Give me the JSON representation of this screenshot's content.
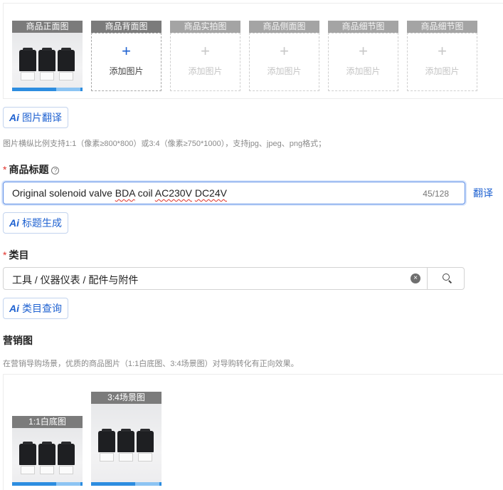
{
  "images": {
    "slots": [
      {
        "label": "商品正面图",
        "has_image": true
      },
      {
        "label": "商品背面图",
        "has_image": false,
        "add_text": "添加图片",
        "active": true
      },
      {
        "label": "商品实拍图",
        "has_image": false,
        "add_text": "添加图片",
        "active": false
      },
      {
        "label": "商品侧面图",
        "has_image": false,
        "add_text": "添加图片",
        "active": false
      },
      {
        "label": "商品细节图",
        "has_image": false,
        "add_text": "添加图片",
        "active": false
      },
      {
        "label": "商品细节图",
        "has_image": false,
        "add_text": "添加图片",
        "active": false
      }
    ],
    "ai_translate_label": "图片翻译",
    "hint": "图片横纵比例支持1:1（像素≥800*800）或3:4（像素≥750*1000），支持jpg、jpeg、png格式；"
  },
  "title_field": {
    "required_mark": "*",
    "label": "商品标题",
    "help_icon": "?",
    "value_parts": [
      "Original solenoid valve ",
      "BDA",
      " coil ",
      "AC230V",
      " ",
      "DC24V"
    ],
    "count": "45/128",
    "translate_label": "翻译",
    "ai_generate_label": "标题生成"
  },
  "category_field": {
    "required_mark": "*",
    "label": "类目",
    "value": "工具 / 仪器仪表 / 配件与附件",
    "clear_icon": "×",
    "ai_query_label": "类目查询"
  },
  "marketing": {
    "label": "营销图",
    "hint": "在营销导购场景，优质的商品图片（1:1白底图、3:4场景图）对导购转化有正向效果。",
    "images": [
      {
        "label": "1:1白底图"
      },
      {
        "label": "3:4场景图"
      }
    ]
  },
  "ai_icon_text": "Ai",
  "colors": {
    "accent": "#1f62d1",
    "required": "#e0322b",
    "slot_label_bg": "#7b7b7b"
  },
  "icons": {
    "add": "plus-icon",
    "search": "search-icon",
    "clear": "clear-icon",
    "help": "help-circle-icon",
    "ai": "ai-icon"
  }
}
